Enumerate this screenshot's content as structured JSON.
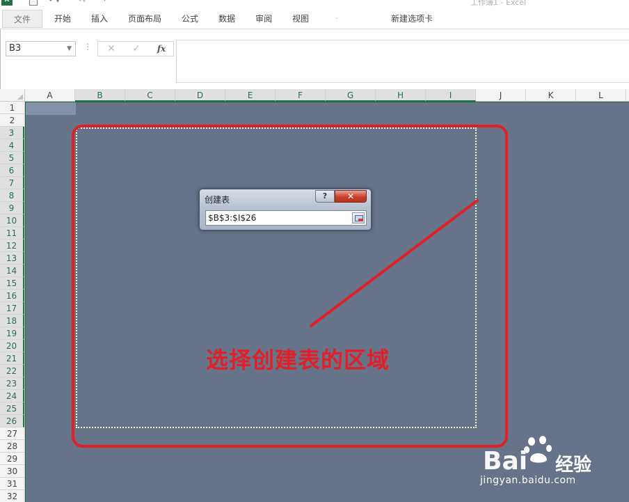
{
  "window": {
    "title": "工作簿1 - Excel"
  },
  "quick_access": {
    "app_icon": "excel-icon",
    "items": [
      "save-icon",
      "undo-icon",
      "redo-icon",
      "customize-icon"
    ]
  },
  "ribbon": {
    "tabs": [
      {
        "id": "file",
        "label": "文件",
        "active": true
      },
      {
        "id": "home",
        "label": "开始"
      },
      {
        "id": "insert",
        "label": "插入"
      },
      {
        "id": "layout",
        "label": "页面布局"
      },
      {
        "id": "formulas",
        "label": "公式"
      },
      {
        "id": "data",
        "label": "数据"
      },
      {
        "id": "review",
        "label": "审阅"
      },
      {
        "id": "view",
        "label": "视图"
      },
      {
        "id": "new",
        "label": "新建选项卡"
      }
    ],
    "separator": "-"
  },
  "formula_bar": {
    "name_box_value": "B3",
    "more_glyph": "⋮",
    "cancel_glyph": "✕",
    "enter_glyph": "✓",
    "fx_label": "fx",
    "formula_value": ""
  },
  "grid": {
    "columns": [
      "A",
      "B",
      "C",
      "D",
      "E",
      "F",
      "G",
      "H",
      "I",
      "J",
      "K",
      "L"
    ],
    "rows": [
      "1",
      "2",
      "3",
      "4",
      "5",
      "6",
      "7",
      "8",
      "9",
      "10",
      "11",
      "12",
      "13",
      "14",
      "15",
      "16",
      "17",
      "18",
      "19",
      "20",
      "21",
      "22",
      "23",
      "24",
      "25",
      "26",
      "27",
      "28",
      "29",
      "30",
      "31",
      "32"
    ],
    "selected_range": "B3:I26",
    "sheet_overlay_color": "#667388"
  },
  "dialog": {
    "title": "创建表",
    "help_label": "?",
    "close_label": "✕",
    "range_value": "$B$3:$I$26"
  },
  "annotation": {
    "text": "选择创建表的区域",
    "color": "#e21f26"
  },
  "watermark": {
    "logo": "Bai",
    "brand": "经验",
    "url": "jingyan.baidu.com"
  }
}
